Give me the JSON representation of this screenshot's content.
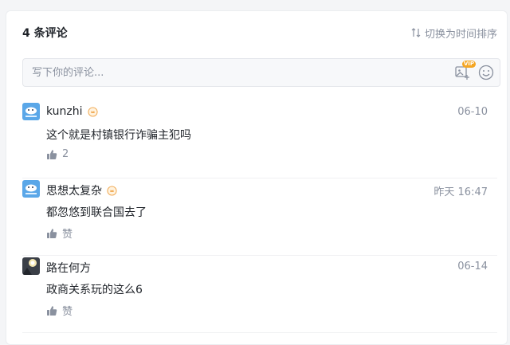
{
  "header": {
    "count_label": "4 条评论",
    "sort_label": "切换为时间排序",
    "sort_icon": "sort-arrows-icon"
  },
  "input": {
    "placeholder": "写下你的评论...",
    "vip_badge": "VIP",
    "image_icon": "add-image-icon",
    "emoji_icon": "emoji-icon"
  },
  "comments": [
    {
      "user": "kunzhi",
      "time": "06-10",
      "text": "这个就是村镇银行诈骗主犯吗",
      "like_label": "2",
      "avatar": "blue-cloud-avatar",
      "badge": true
    },
    {
      "user": "思想太复杂",
      "time": "昨天 16:47",
      "text": "都忽悠到联合国去了",
      "like_label": "赞",
      "avatar": "blue-cloud-avatar",
      "badge": true
    },
    {
      "user": "路在何方",
      "time": "06-14",
      "text": "政商关系玩的这么6",
      "like_label": "赞",
      "avatar": "photo-avatar",
      "badge": false
    }
  ],
  "colors": {
    "muted": "#8a919f",
    "text": "#1f2329",
    "vip": "#f5a623",
    "avatar_blue": "#5aa7e8"
  }
}
